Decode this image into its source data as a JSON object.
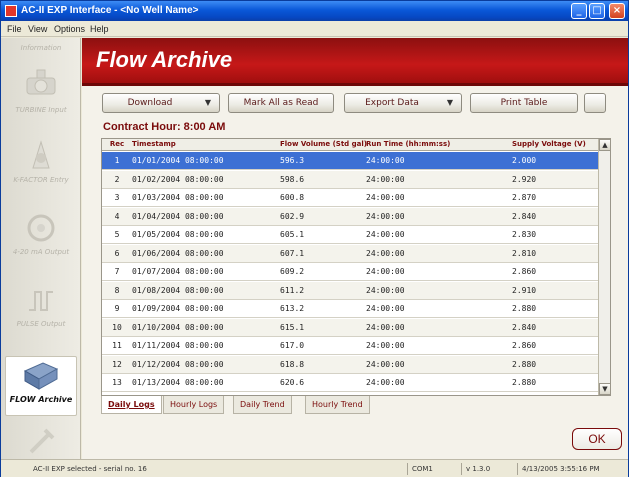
{
  "window": {
    "title": "AC-II EXP Interface - <No Well Name>"
  },
  "menu": {
    "items": [
      "File",
      "View",
      "Options",
      "Help"
    ]
  },
  "sidebar": {
    "items": [
      {
        "label": "Information",
        "icon": "info-icon"
      },
      {
        "label": "TURBINE Input",
        "icon": "turbine-icon"
      },
      {
        "label": "K-FACTOR Entry",
        "icon": "kfactor-icon"
      },
      {
        "label": "4-20 mA Output",
        "icon": "analog-output-icon"
      },
      {
        "label": "PULSE Output",
        "icon": "pulse-output-icon"
      },
      {
        "label": "FLOW Archive",
        "icon": "flow-archive-icon"
      },
      {
        "label": "",
        "icon": "tools-icon"
      }
    ]
  },
  "header": {
    "title": "Flow Archive"
  },
  "toolbar": {
    "download": "Download",
    "mark_all_read": "Mark All as Read",
    "export_data": "Export Data",
    "print_table": "Print Table"
  },
  "contract_hour": "Contract Hour: 8:00 AM",
  "table": {
    "columns": [
      "Rec",
      "Timestamp",
      "Flow Volume (Std gal)",
      "Run Time (hh:mm:ss)",
      "Supply Voltage (V)"
    ],
    "rows": [
      [
        "1",
        "01/01/2004 08:00:00",
        "596.3",
        "24:00:00",
        "2.000"
      ],
      [
        "2",
        "01/02/2004 08:00:00",
        "598.6",
        "24:00:00",
        "2.920"
      ],
      [
        "3",
        "01/03/2004 08:00:00",
        "600.8",
        "24:00:00",
        "2.870"
      ],
      [
        "4",
        "01/04/2004 08:00:00",
        "602.9",
        "24:00:00",
        "2.840"
      ],
      [
        "5",
        "01/05/2004 08:00:00",
        "605.1",
        "24:00:00",
        "2.830"
      ],
      [
        "6",
        "01/06/2004 08:00:00",
        "607.1",
        "24:00:00",
        "2.810"
      ],
      [
        "7",
        "01/07/2004 08:00:00",
        "609.2",
        "24:00:00",
        "2.860"
      ],
      [
        "8",
        "01/08/2004 08:00:00",
        "611.2",
        "24:00:00",
        "2.910"
      ],
      [
        "9",
        "01/09/2004 08:00:00",
        "613.2",
        "24:00:00",
        "2.880"
      ],
      [
        "10",
        "01/10/2004 08:00:00",
        "615.1",
        "24:00:00",
        "2.840"
      ],
      [
        "11",
        "01/11/2004 08:00:00",
        "617.0",
        "24:00:00",
        "2.860"
      ],
      [
        "12",
        "01/12/2004 08:00:00",
        "618.8",
        "24:00:00",
        "2.880"
      ],
      [
        "13",
        "01/13/2004 08:00:00",
        "620.6",
        "24:00:00",
        "2.880"
      ]
    ],
    "selected_row": 0
  },
  "tabs": [
    "Daily Logs",
    "Hourly Logs",
    "Daily Trend",
    "Hourly Trend"
  ],
  "ok_label": "OK",
  "status": {
    "device": "AC-II EXP selected - serial no. 16",
    "port": "COM1",
    "version": "v 1.3.0",
    "datetime": "4/13/2005 3:55:16 PM"
  },
  "colors": {
    "accent": "#c61818",
    "selection": "#3d70d4",
    "titlebar": "#0a58d8"
  }
}
